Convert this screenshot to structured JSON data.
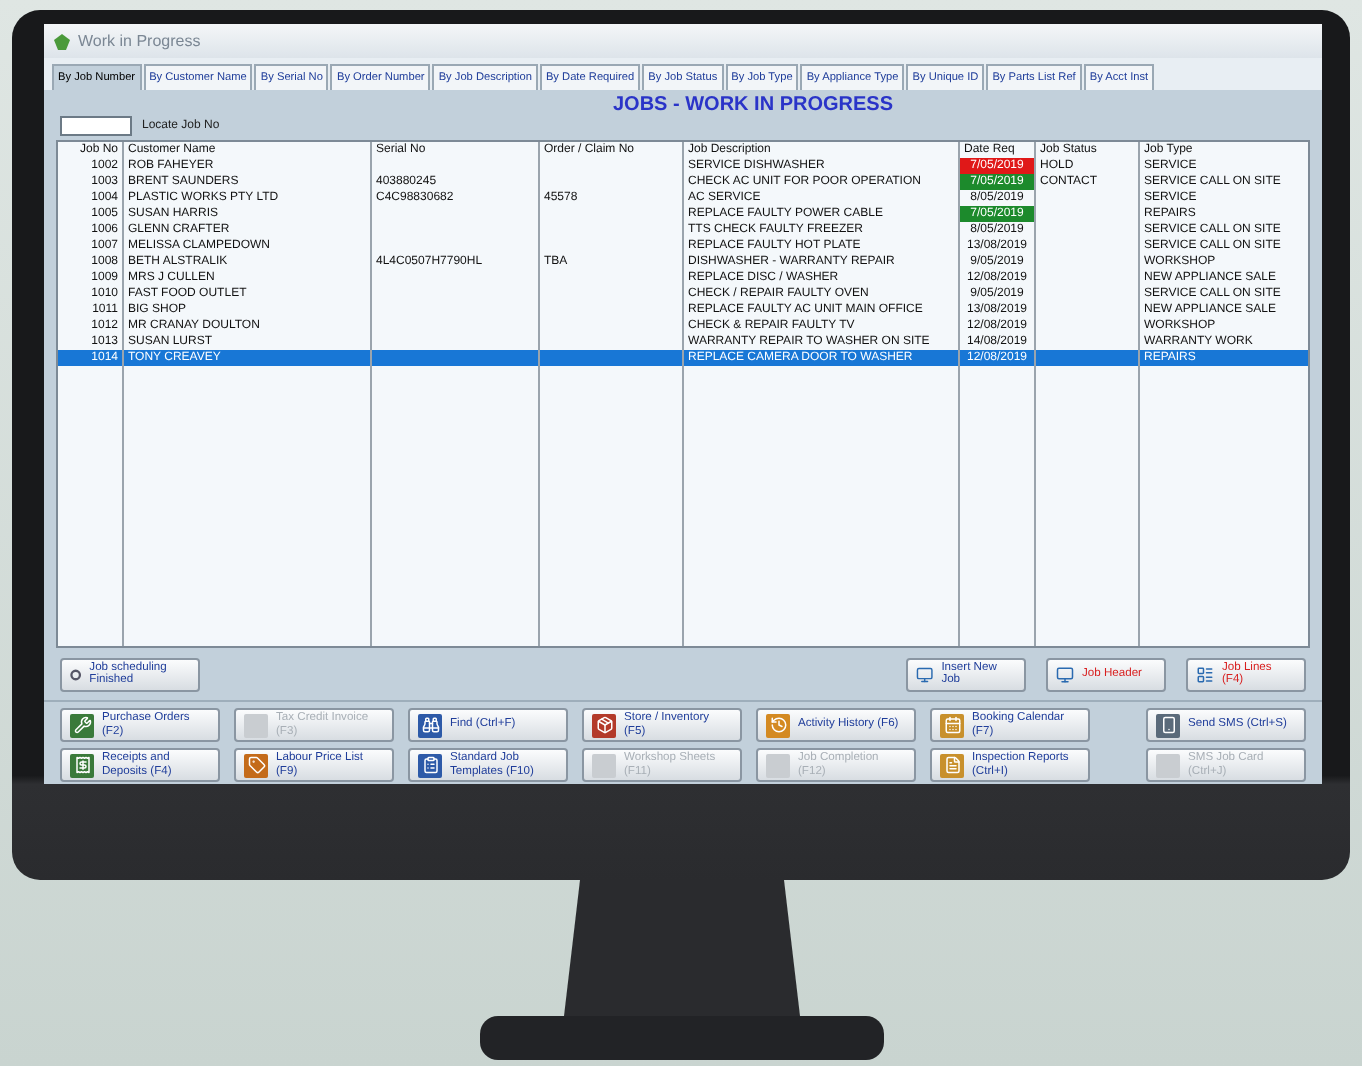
{
  "window": {
    "title": "Work in Progress"
  },
  "tabs": [
    {
      "label": "By Job Number",
      "selected": true
    },
    {
      "label": "By Customer Name",
      "selected": false
    },
    {
      "label": "By Serial No",
      "selected": false
    },
    {
      "label": "By Order Number",
      "selected": false
    },
    {
      "label": "By Job Description",
      "selected": false
    },
    {
      "label": "By Date Required",
      "selected": false
    },
    {
      "label": "By Job Status",
      "selected": false
    },
    {
      "label": "By Job Type",
      "selected": false
    },
    {
      "label": "By Appliance Type",
      "selected": false
    },
    {
      "label": "By Unique ID",
      "selected": false
    },
    {
      "label": "By Parts List Ref",
      "selected": false
    },
    {
      "label": "By Acct Inst",
      "selected": false
    }
  ],
  "header": {
    "title": "JOBS - WORK IN PROGRESS",
    "locate_label": "Locate Job No"
  },
  "table": {
    "columns": [
      "Job No",
      "Customer Name",
      "Serial No",
      "Order / Claim No",
      "Job Description",
      "Date Req",
      "Job Status",
      "Job Type"
    ],
    "rows": [
      {
        "job_no": "1002",
        "customer": "ROB FAHEYER",
        "description": "SERVICE DISHWASHER",
        "date_req": "7/05/2019",
        "color": "#e01818",
        "status": "HOLD",
        "type": "SERVICE",
        "selected": false
      },
      {
        "job_no": "1003",
        "customer": "BRENT SAUNDERS",
        "serial": "403880245",
        "description": "CHECK AC UNIT FOR POOR OPERATION",
        "date_req": "7/05/2019",
        "color": "#1c8a2c",
        "status": "CONTACT",
        "type": "SERVICE CALL ON SITE",
        "selected": false
      },
      {
        "job_no": "1004",
        "customer": "PLASTIC WORKS PTY LTD",
        "serial": "C4C98830682",
        "order": "45578",
        "description": "AC SERVICE",
        "date_req": "8/05/2019",
        "type": "SERVICE",
        "selected": false
      },
      {
        "job_no": "1005",
        "customer": "SUSAN HARRIS",
        "description": "REPLACE FAULTY POWER CABLE",
        "date_req": "7/05/2019",
        "color": "#1c8a2c",
        "type": "REPAIRS",
        "selected": false
      },
      {
        "job_no": "1006",
        "customer": "GLENN CRAFTER",
        "description": "TTS CHECK FAULTY FREEZER",
        "date_req": "8/05/2019",
        "type": "SERVICE CALL ON SITE",
        "selected": false
      },
      {
        "job_no": "1007",
        "customer": "MELISSA CLAMPEDOWN",
        "description": "REPLACE FAULTY HOT PLATE",
        "date_req": "13/08/2019",
        "type": "SERVICE CALL ON SITE",
        "selected": false
      },
      {
        "job_no": "1008",
        "customer": "BETH ALSTRALIK",
        "serial": "4L4C0507H7790HL",
        "order": "TBA",
        "description": "DISHWASHER - WARRANTY REPAIR",
        "date_req": "9/05/2019",
        "type": "WORKSHOP",
        "selected": false
      },
      {
        "job_no": "1009",
        "customer": "MRS J CULLEN",
        "description": "REPLACE DISC / WASHER",
        "date_req": "12/08/2019",
        "type": "NEW APPLIANCE SALE",
        "selected": false
      },
      {
        "job_no": "1010",
        "customer": "FAST FOOD OUTLET",
        "description": "CHECK / REPAIR FAULTY OVEN",
        "date_req": "9/05/2019",
        "type": "SERVICE CALL ON SITE",
        "selected": false
      },
      {
        "job_no": "1011",
        "customer": "BIG SHOP",
        "description": "REPLACE FAULTY AC UNIT MAIN OFFICE",
        "date_req": "13/08/2019",
        "type": "NEW APPLIANCE SALE",
        "selected": false
      },
      {
        "job_no": "1012",
        "customer": "MR CRANAY DOULTON",
        "description": "CHECK & REPAIR FAULTY TV",
        "date_req": "12/08/2019",
        "type": "WORKSHOP",
        "selected": false
      },
      {
        "job_no": "1013",
        "customer": "SUSAN LURST",
        "description": "WARRANTY REPAIR TO WASHER ON SITE",
        "date_req": "14/08/2019",
        "type": "WARRANTY WORK",
        "selected": false
      },
      {
        "job_no": "1014",
        "customer": "TONY CREAVEY",
        "description": "REPLACE CAMERA DOOR TO WASHER",
        "date_req": "12/08/2019",
        "type": "REPAIRS",
        "selected": true
      }
    ]
  },
  "action_bar": {
    "left": {
      "label": "Job scheduling Finished"
    },
    "right": [
      {
        "label": "Insert New Job",
        "kind": "normal"
      },
      {
        "label": "Job Header",
        "kind": "alert"
      },
      {
        "label": "Job Lines (F4)",
        "kind": "alert"
      }
    ]
  },
  "function_buttons": [
    [
      {
        "label": "Purchase Orders (F2)",
        "disabled": false
      },
      {
        "label": "Tax Credit Invoice (F3)",
        "disabled": true
      },
      {
        "label": "Find (Ctrl+F)",
        "disabled": false
      },
      {
        "label": "Store / Inventory (F5)",
        "disabled": false
      },
      {
        "label": "Activity History (F6)",
        "disabled": false
      },
      {
        "label": "Booking Calendar (F7)",
        "disabled": false
      },
      {
        "label": "Send SMS (Ctrl+S)",
        "disabled": false
      }
    ],
    [
      {
        "label": "Receipts and Deposits (F4)",
        "disabled": false
      },
      {
        "label": "Labour Price List (F9)",
        "disabled": false
      },
      {
        "label": "Standard Job Templates (F10)",
        "disabled": false
      },
      {
        "label": "Workshop Sheets (F11)",
        "disabled": true
      },
      {
        "label": "Job Completion (F12)",
        "disabled": true
      },
      {
        "label": "Inspection Reports (Ctrl+I)",
        "disabled": false
      },
      {
        "label": "SMS Job Card (Ctrl+J)",
        "disabled": true
      }
    ]
  ]
}
